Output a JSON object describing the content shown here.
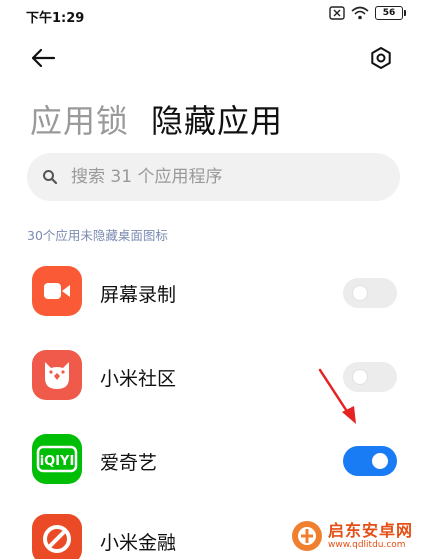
{
  "status_bar": {
    "time": "下午1:29",
    "battery": "56"
  },
  "header": {
    "tabs": [
      {
        "label": "应用锁",
        "active": false
      },
      {
        "label": "隐藏应用",
        "active": true
      }
    ]
  },
  "search": {
    "placeholder": "搜索 31 个应用程序"
  },
  "section": {
    "label": "30个应用未隐藏桌面图标"
  },
  "apps": [
    {
      "name": "屏幕录制",
      "hidden": false,
      "icon": "screen-record-icon",
      "color": "#fb5a36"
    },
    {
      "name": "小米社区",
      "hidden": false,
      "icon": "mi-community-icon",
      "color": "#f05a4a"
    },
    {
      "name": "爱奇艺",
      "hidden": true,
      "icon": "iqiyi-icon",
      "color": "#00be06"
    },
    {
      "name": "小米金融",
      "hidden": false,
      "icon": "mi-finance-icon",
      "color": "#ea4b26"
    }
  ],
  "watermark": {
    "title": "启东安卓网",
    "url": "www.qdlitdu.com"
  },
  "colors": {
    "accent": "#1a7cf5",
    "arrow": "#e62323"
  }
}
